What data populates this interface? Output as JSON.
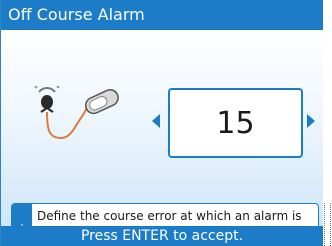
{
  "window": {
    "title": "Off Course Alarm"
  },
  "graphic": {
    "icon": "remote-control-icon"
  },
  "value_selector": {
    "value": "15",
    "decrement_icon": "arrow-left-icon",
    "increment_icon": "arrow-right-icon"
  },
  "info": {
    "icon_glyph": "i",
    "text": "Define the course error at which an alarm is sounded."
  },
  "footer": {
    "hint": "Press ENTER to accept."
  },
  "colors": {
    "accent": "#1c7cc8",
    "background": "#ffffff"
  }
}
